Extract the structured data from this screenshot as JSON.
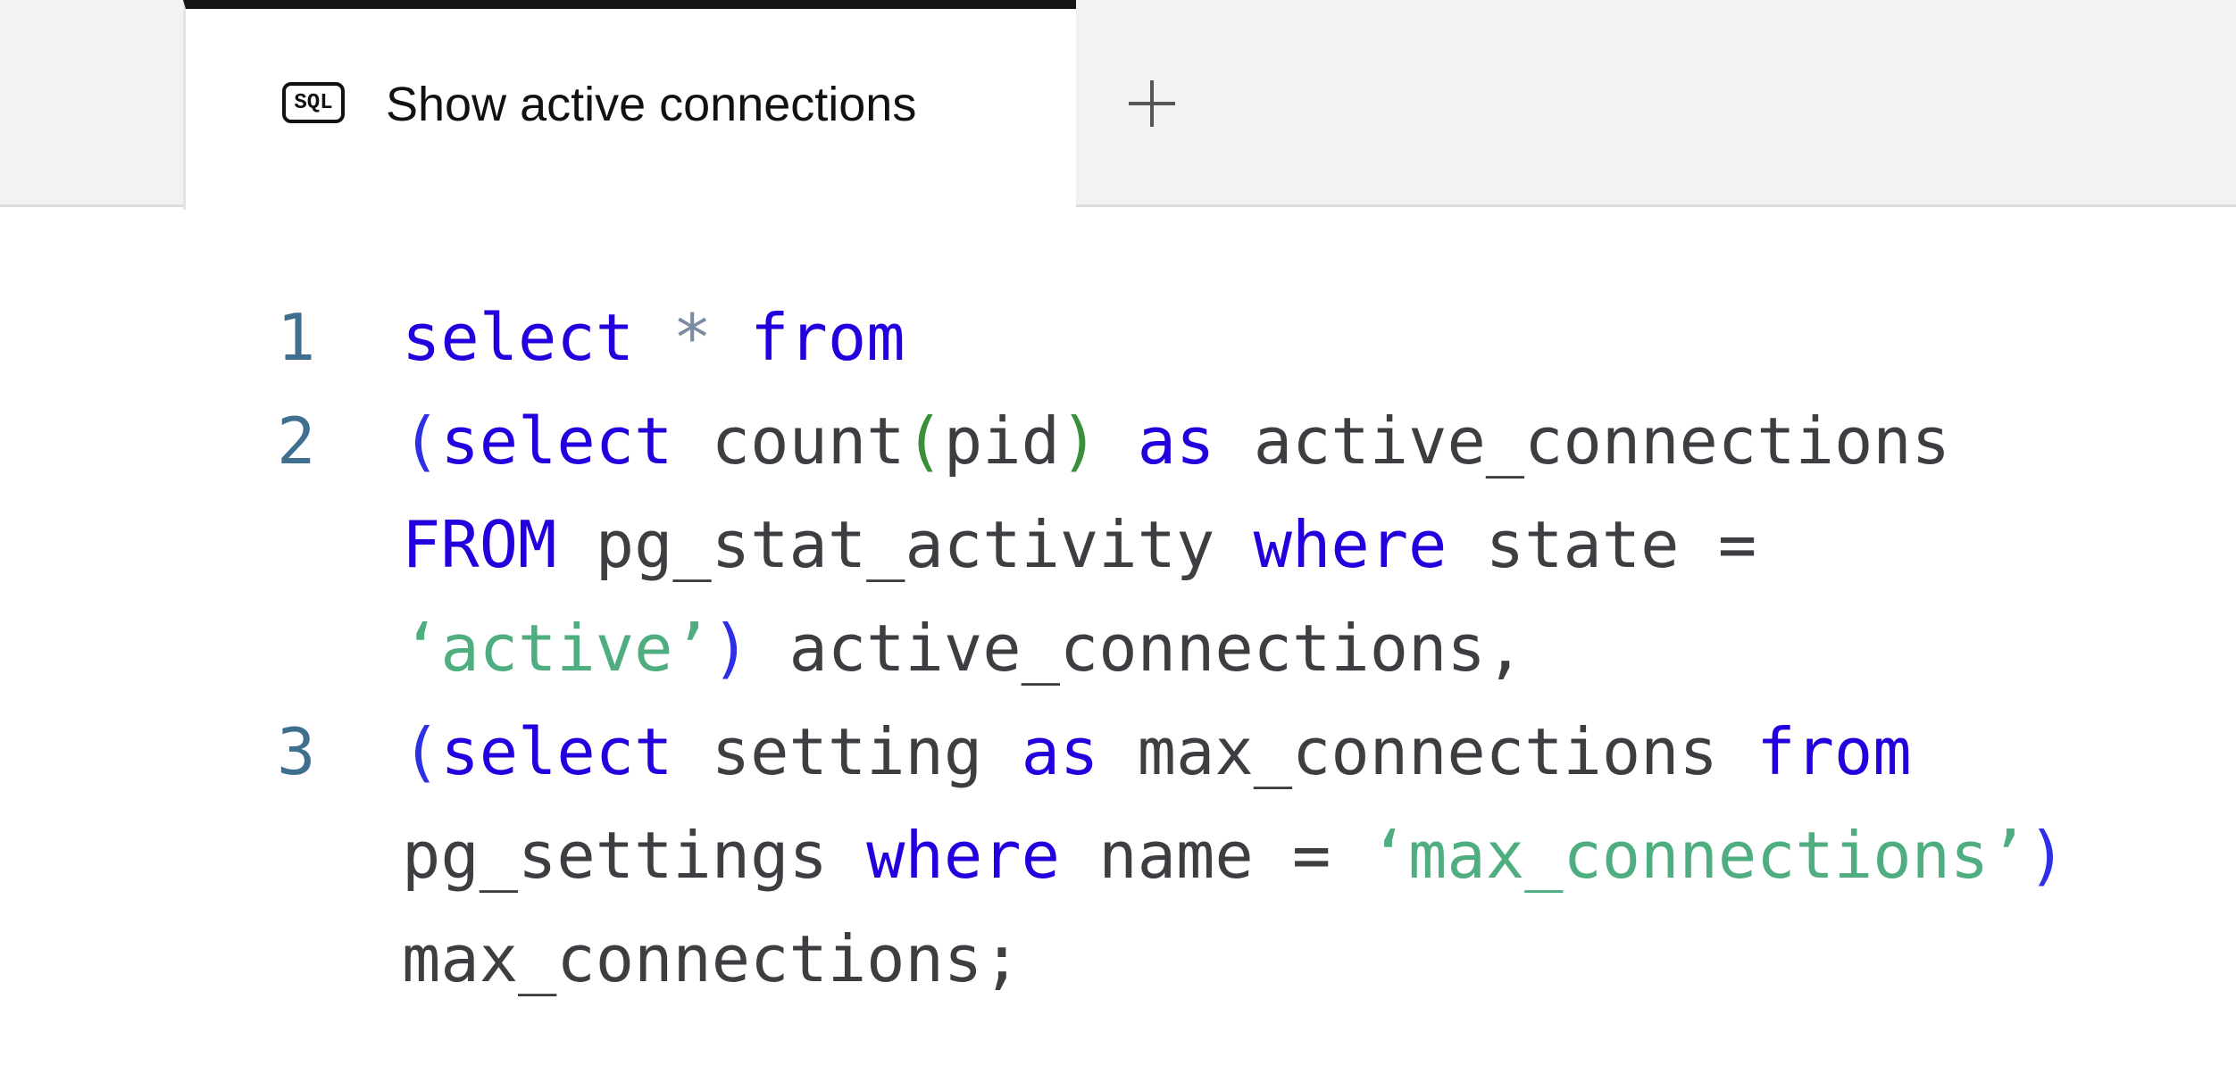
{
  "tabs": {
    "active": {
      "badge": "SQL",
      "title": "Show active connections"
    },
    "add_icon": "plus-icon"
  },
  "editor": {
    "line_numbers": [
      "1",
      "2",
      "3"
    ],
    "line1": {
      "t1": "select",
      "t2": " ",
      "t3": "*",
      "t4": " ",
      "t5": "from"
    },
    "line2a": {
      "t1": "(",
      "t2": "select",
      "t3": " count",
      "t4": "(",
      "t5": "pid",
      "t6": ")",
      "t7": " ",
      "t8": "as",
      "t9": " active_connections"
    },
    "line2b": {
      "t1": "FROM",
      "t2": " pg_stat_activity ",
      "t3": "where",
      "t4": " state ="
    },
    "line2c": {
      "t1": "‘active’",
      "t2": ")",
      "t3": " active_connections,"
    },
    "line3a": {
      "t1": "(",
      "t2": "select",
      "t3": " setting ",
      "t4": "as",
      "t5": " max_connections ",
      "t6": "from"
    },
    "line3b": {
      "t1": "pg_settings ",
      "t2": "where",
      "t3": " name = ",
      "t4": "‘max_connections’",
      "t5": ")"
    },
    "line3c": {
      "t1": "max_connections;"
    }
  },
  "colors": {
    "keyword": "#2200dd",
    "string": "#4fae80",
    "identifier": "#3d3d42",
    "line_number": "#3f6f8f",
    "tab_bar": "#f2f2f2",
    "active_tab_border": "#161616"
  }
}
